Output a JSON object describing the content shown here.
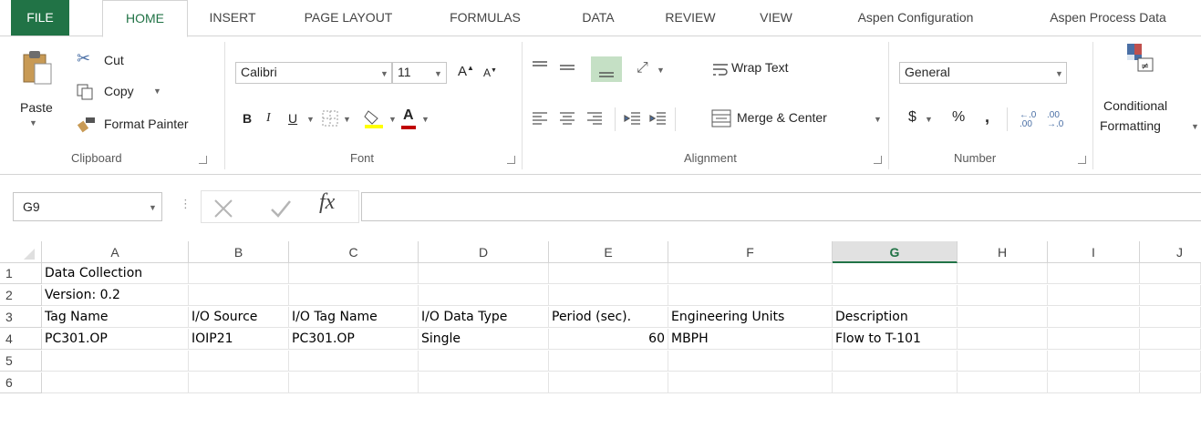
{
  "ribbon_tabs": [
    "FILE",
    "HOME",
    "INSERT",
    "PAGE LAYOUT",
    "FORMULAS",
    "DATA",
    "REVIEW",
    "VIEW",
    "Aspen Configuration",
    "Aspen Process Data"
  ],
  "clipboard": {
    "paste_label": "Paste",
    "cut_label": "Cut",
    "copy_label": "Copy",
    "format_painter_label": "Format Painter",
    "group_label": "Clipboard"
  },
  "font": {
    "font_name": "Calibri",
    "font_size": "11",
    "bold": "B",
    "italic": "I",
    "underline": "U",
    "group_label": "Font"
  },
  "alignment": {
    "wrap_text_label": "Wrap Text",
    "merge_center_label": "Merge & Center",
    "group_label": "Alignment"
  },
  "number": {
    "format_value": "General",
    "currency": "$",
    "percent": "%",
    "comma": ",",
    "inc_decimal": "←.0 .00",
    "dec_decimal": ".00 →.0",
    "group_label": "Number"
  },
  "styles": {
    "conditional_label_1": "Conditional",
    "conditional_label_2": "Formatting"
  },
  "formula_bar": {
    "name_box": "G9",
    "fx": "fx",
    "value": ""
  },
  "grid": {
    "columns": [
      "A",
      "B",
      "C",
      "D",
      "E",
      "F",
      "G",
      "H",
      "I",
      "J"
    ],
    "selected_column": "G",
    "rows": [
      "1",
      "2",
      "3",
      "4",
      "5",
      "6"
    ],
    "cells": {
      "A1": "Data Collection",
      "A2": "Version: 0.2",
      "A3": "Tag Name",
      "B3": "I/O Source",
      "C3": "I/O Tag Name",
      "D3": "I/O Data Type",
      "E3": "Period (sec).",
      "F3": "Engineering Units",
      "G3": "Description",
      "A4": "PC301.OP",
      "B4": "IOIP21",
      "C4": "PC301.OP",
      "D4": "Single",
      "E4": "60",
      "F4": "MBPH",
      "G4": "Flow to T-101"
    }
  },
  "colors": {
    "accent": "#217346",
    "font_color_bar": "#c00000",
    "highlight_bar": "#ffff00"
  }
}
